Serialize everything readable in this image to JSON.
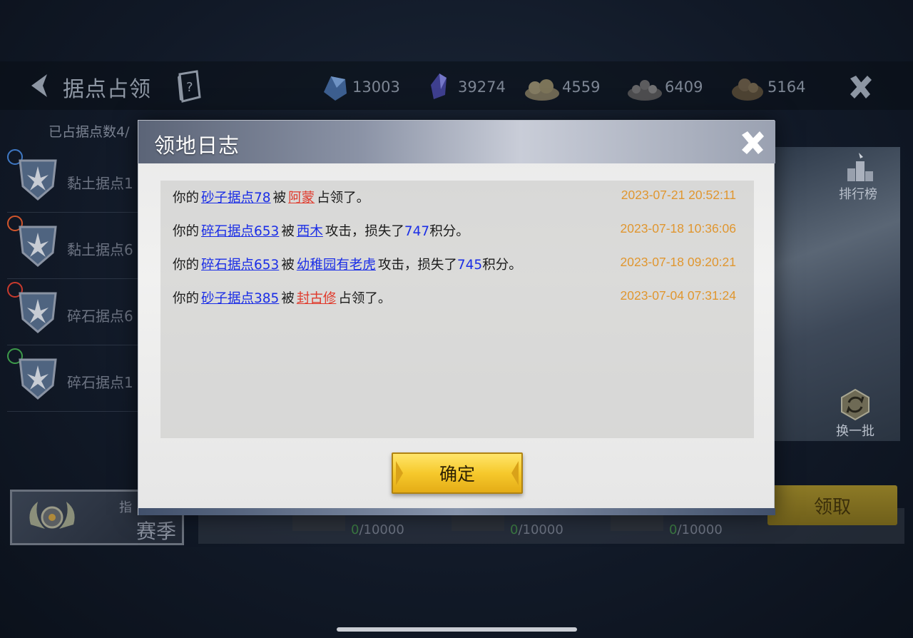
{
  "header": {
    "title": "据点占领",
    "resources": [
      {
        "icon": "blue-crystal-icon",
        "value": "13003"
      },
      {
        "icon": "purple-crystal-icon",
        "value": "39274"
      },
      {
        "icon": "clay-pile-icon",
        "value": "4559"
      },
      {
        "icon": "gravel-pile-icon",
        "value": "6409"
      },
      {
        "icon": "ore-pile-icon",
        "value": "5164"
      }
    ]
  },
  "occupied": {
    "label": "已占据点数4/"
  },
  "strongholds": [
    {
      "name": "黏土据点1",
      "badge_color": "#3f78c4"
    },
    {
      "name": "黏土据点6",
      "badge_color": "#d2562c"
    },
    {
      "name": "碎石据点6",
      "badge_color": "#c93a2d"
    },
    {
      "name": "碎石据点1",
      "badge_color": "#3d9a4a"
    }
  ],
  "season": {
    "sub": "指",
    "label": "赛季"
  },
  "progress": [
    {
      "current": "0",
      "total": "/10000"
    },
    {
      "current": "0",
      "total": "/10000"
    },
    {
      "current": "0",
      "total": "/10000"
    }
  ],
  "right_panel": {
    "rank_label": "排行榜",
    "swap_label": "换一批",
    "claim_label": "领取"
  },
  "modal": {
    "title": "领地日志",
    "confirm_label": "确定",
    "entries": [
      {
        "prefix": "你的",
        "target": "砂子据点78",
        "by": "被",
        "actor": "阿蒙",
        "actor_color": "red",
        "suffix": "占领了。",
        "points_pre": "",
        "points": "",
        "points_post": "",
        "time": "2023-07-21 20:52:11"
      },
      {
        "prefix": "你的",
        "target": "碎石据点653",
        "by": "被",
        "actor": "西木",
        "actor_color": "blue",
        "suffix": "攻击，损失了",
        "points_pre": "",
        "points": "747",
        "points_post": "积分。",
        "time": "2023-07-18 10:36:06"
      },
      {
        "prefix": "你的",
        "target": "碎石据点653",
        "by": "被",
        "actor": "幼稚园有老虎",
        "actor_color": "blue",
        "suffix": "攻击，损失了",
        "points_pre": "",
        "points": "745",
        "points_post": "积分。",
        "time": "2023-07-18 09:20:21"
      },
      {
        "prefix": "你的",
        "target": "砂子据点385",
        "by": "被",
        "actor": "封古修",
        "actor_color": "red",
        "suffix": "占领了。",
        "points_pre": "",
        "points": "",
        "points_post": "",
        "time": "2023-07-04 07:31:24"
      }
    ]
  },
  "colors": {
    "link_blue": "#1b2ee6",
    "link_red": "#e03a2c",
    "time_orange": "#e0962f",
    "button_gold": "#f6c92c"
  }
}
